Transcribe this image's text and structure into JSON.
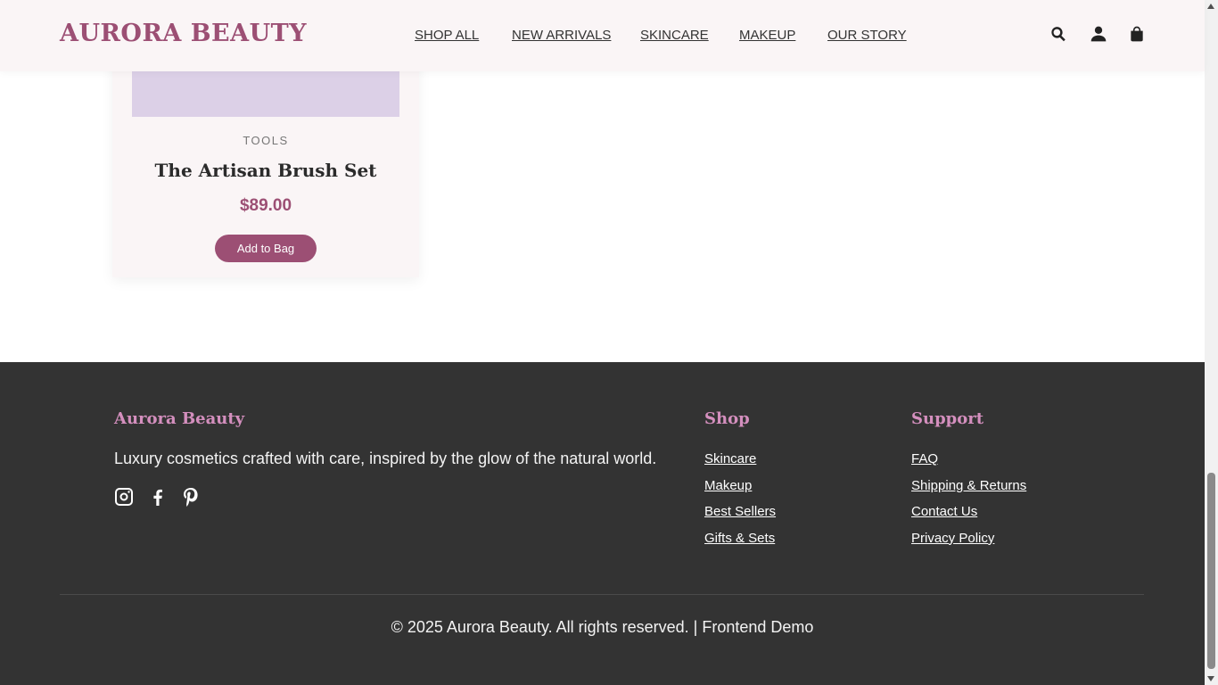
{
  "header": {
    "logo": "AURORA BEAUTY",
    "nav": [
      "SHOP ALL",
      "NEW ARRIVALS",
      "SKINCARE",
      "MAKEUP",
      "OUR STORY"
    ],
    "icons": [
      "search-icon",
      "user-icon",
      "shopping-bag-icon"
    ]
  },
  "product": {
    "category": "TOOLS",
    "title": "The Artisan Brush Set",
    "price": "$89.00",
    "button": "Add to Bag",
    "image_color": "#dcd0e7"
  },
  "footer": {
    "brand": "Aurora Beauty",
    "description": "Luxury cosmetics crafted with care, inspired by the glow of the natural world.",
    "social": [
      "instagram-icon",
      "facebook-icon",
      "pinterest-icon"
    ],
    "shop": {
      "title": "Shop",
      "links": [
        "Skincare",
        "Makeup",
        "Best Sellers",
        "Gifts & Sets"
      ]
    },
    "support": {
      "title": "Support",
      "links": [
        "FAQ",
        "Shipping & Returns",
        "Contact Us",
        "Privacy Policy"
      ]
    },
    "copyright": "© 2025 Aurora Beauty. All rights reserved. | Frontend Demo"
  },
  "colors": {
    "accent": "#9c4f74",
    "footer_heading": "#d48fbe",
    "footer_bg": "#333333",
    "header_bg": "#faf5f6"
  }
}
